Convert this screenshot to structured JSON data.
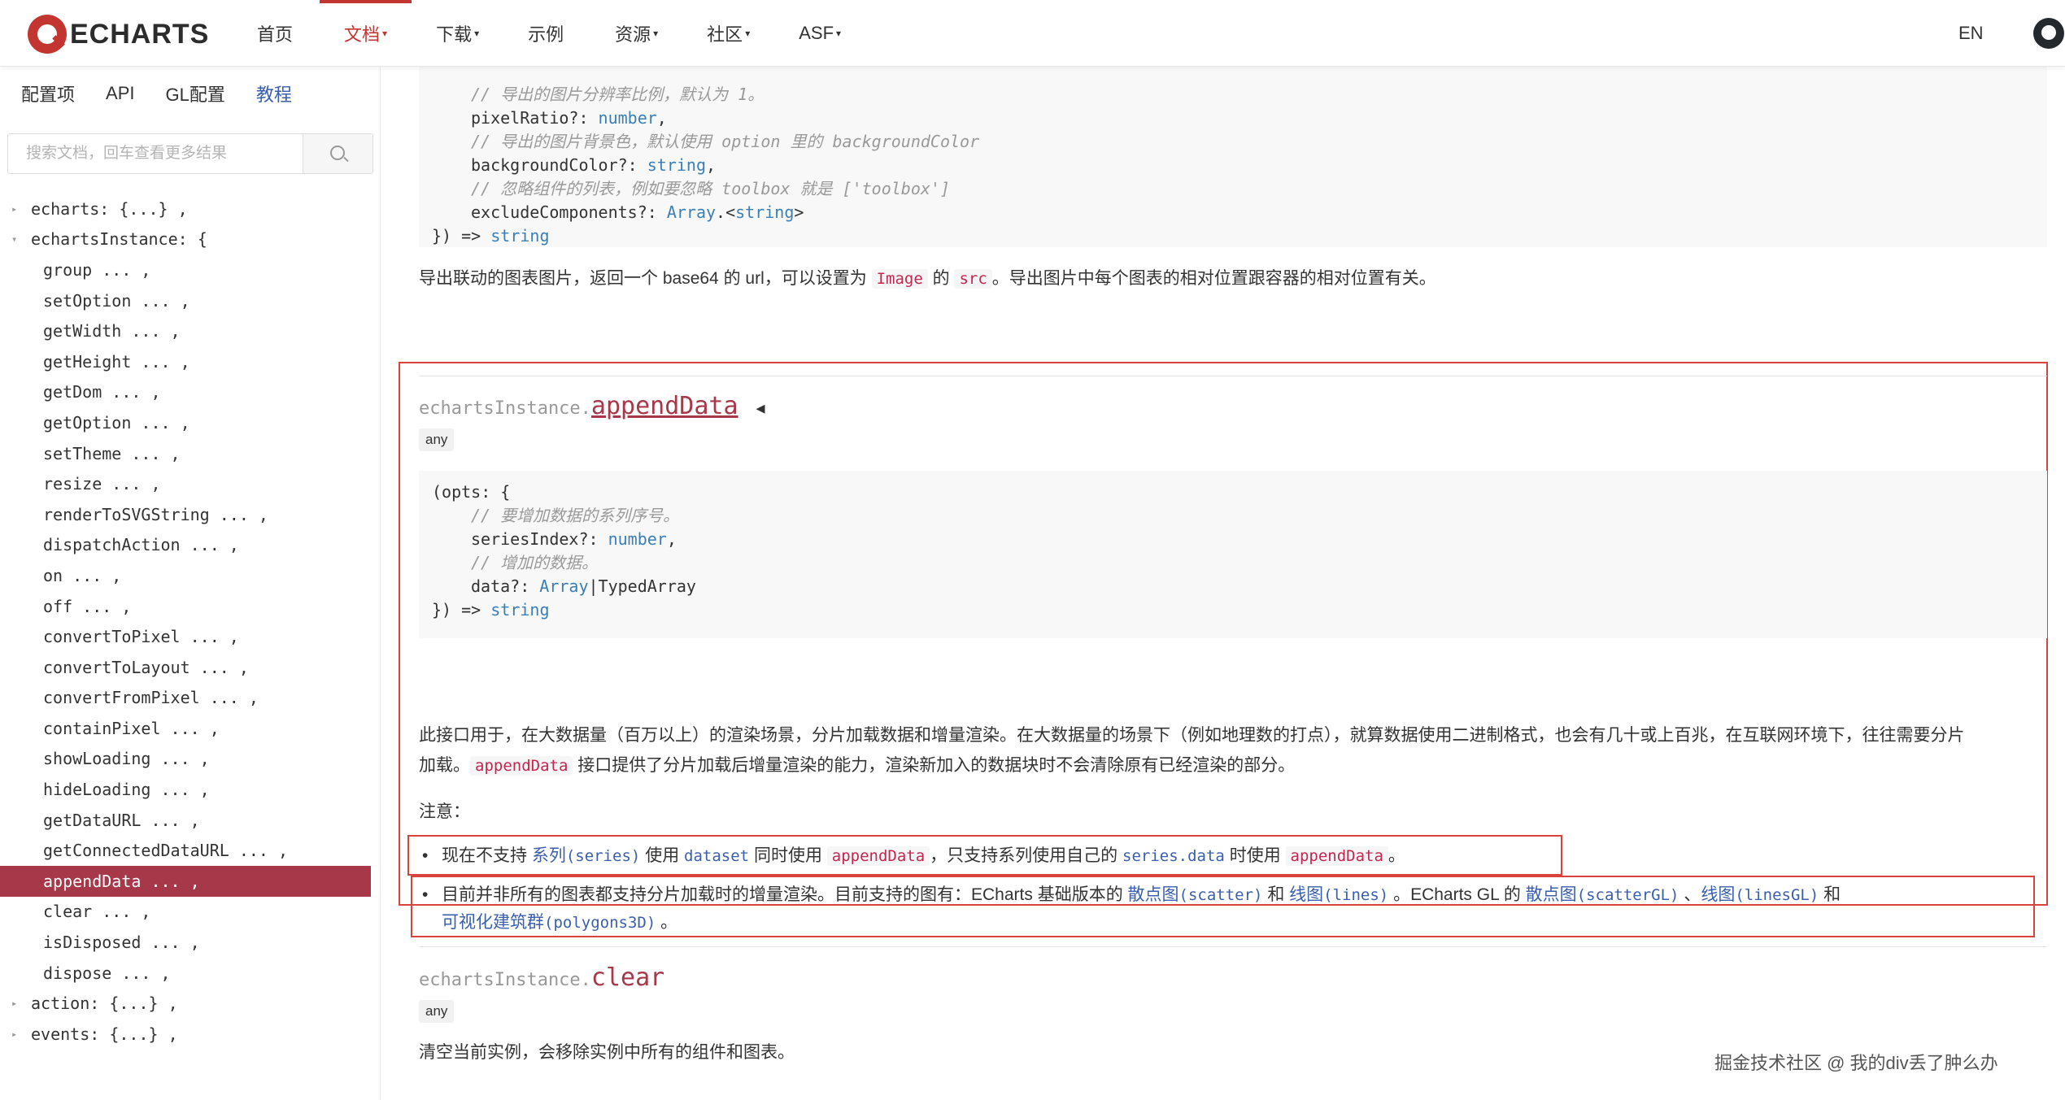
{
  "nav": {
    "logo_text": "ECHARTS",
    "items": [
      {
        "label": "首页",
        "caret": ""
      },
      {
        "label": "文档",
        "caret": "▾"
      },
      {
        "label": "下载",
        "caret": "▾"
      },
      {
        "label": "示例",
        "caret": ""
      },
      {
        "label": "资源",
        "caret": "▾"
      },
      {
        "label": "社区",
        "caret": "▾"
      },
      {
        "label": "ASF",
        "caret": "▾"
      }
    ],
    "lang": "EN"
  },
  "sidebar": {
    "tabs": [
      "配置项",
      "API",
      "GL配置",
      "教程"
    ],
    "search_placeholder": "搜索文档，回车查看更多结果",
    "tree": [
      {
        "text": "echarts: {...} ,",
        "lvl": 0,
        "arrow": "▸"
      },
      {
        "text": "echartsInstance: {",
        "lvl": 0,
        "arrow": "▾"
      },
      {
        "text": "group ... ,",
        "lvl": 1
      },
      {
        "text": "setOption ... ,",
        "lvl": 1
      },
      {
        "text": "getWidth ... ,",
        "lvl": 1
      },
      {
        "text": "getHeight ... ,",
        "lvl": 1
      },
      {
        "text": "getDom ... ,",
        "lvl": 1
      },
      {
        "text": "getOption ... ,",
        "lvl": 1
      },
      {
        "text": "setTheme ... ,",
        "lvl": 1
      },
      {
        "text": "resize ... ,",
        "lvl": 1
      },
      {
        "text": "renderToSVGString ... ,",
        "lvl": 1
      },
      {
        "text": "dispatchAction ... ,",
        "lvl": 1
      },
      {
        "text": "on ... ,",
        "lvl": 1
      },
      {
        "text": "off ... ,",
        "lvl": 1
      },
      {
        "text": "convertToPixel ... ,",
        "lvl": 1
      },
      {
        "text": "convertToLayout ... ,",
        "lvl": 1
      },
      {
        "text": "convertFromPixel ... ,",
        "lvl": 1
      },
      {
        "text": "containPixel ... ,",
        "lvl": 1
      },
      {
        "text": "showLoading ... ,",
        "lvl": 1
      },
      {
        "text": "hideLoading ... ,",
        "lvl": 1
      },
      {
        "text": "getDataURL ... ,",
        "lvl": 1
      },
      {
        "text": "getConnectedDataURL ... ,",
        "lvl": 1
      },
      {
        "text": "appendData ... ,",
        "lvl": 1,
        "selected": true
      },
      {
        "text": "clear ... ,",
        "lvl": 1
      },
      {
        "text": "isDisposed ... ,",
        "lvl": 1
      },
      {
        "text": "dispose ... ,",
        "lvl": 1
      },
      {
        "text": "action: {...} ,",
        "lvl": 0,
        "arrow": "▸"
      },
      {
        "text": "events: {...} ,",
        "lvl": 0,
        "arrow": "▸"
      }
    ]
  },
  "top_code": {
    "c1": "// 导出的图片分辨率比例，默认为 1。",
    "l1a": "pixelRatio?: ",
    "l1b": "number",
    "l1c": ",",
    "c2": "// 导出的图片背景色，默认使用 option 里的 backgroundColor",
    "l2a": "backgroundColor?: ",
    "l2b": "string",
    "l2c": ",",
    "c3": "// 忽略组件的列表，例如要忽略 toolbox 就是 ['toolbox']",
    "l3a": "excludeComponents?: ",
    "l3b": "Array",
    "l3c": ".<",
    "l3d": "string",
    "l3e": ">",
    "end_a": "}) => ",
    "end_b": "string"
  },
  "top_desc": {
    "t1": "导出联动的图表图片，返回一个 base64 的 url，可以设置为 ",
    "code1": "Image",
    "t2": " 的 ",
    "code2": "src",
    "t3": "。导出图片中每个图表的相对位置跟容器的相对位置有关。"
  },
  "append": {
    "prefix": "echartsInstance.",
    "name": "appendData",
    "back_icon": "◂",
    "badge": "any",
    "code": {
      "open": "(opts: {",
      "c1": "// 要增加数据的系列序号。",
      "l1a": "seriesIndex?: ",
      "l1b": "number",
      "l1c": ",",
      "c2": "// 增加的数据。",
      "l2a": "data?: ",
      "l2b": "Array",
      "l2c": "|TypedArray",
      "end_a": "}) => ",
      "end_b": "string"
    },
    "desc1": "此接口用于，在大数据量（百万以上）的渲染场景，分片加载数据和增量渲染。在大数据量的场景下（例如地理数的打点），就算数据使用二进制格式，也会有几十或上百兆，在互联网环境下，往往需要分片",
    "desc2a": "加载。",
    "desc2_code": "appendData",
    "desc2b": " 接口提供了分片加载后增量渲染的能力，渲染新加入的数据块时不会清除原有已经渲染的部分。",
    "note_label": "注意：",
    "b1": {
      "t1": "现在不支持 ",
      "link1": "系列",
      "link1m": "(series)",
      "t2": " 使用 ",
      "code1": "dataset",
      "t3": " 同时使用 ",
      "code2": "appendData",
      "t4": "，只支持系列使用自己的 ",
      "code3": "series.data",
      "t5": " 时使用 ",
      "code4": "appendData",
      "t6": "。"
    },
    "b2": {
      "t1": "目前并非所有的图表都支持分片加载时的增量渲染。目前支持的图有：ECharts 基础版本的 ",
      "l1": "散点图",
      "l1m": "(scatter)",
      "t2": " 和 ",
      "l2": "线图",
      "l2m": "(lines)",
      "t3": " 。ECharts GL 的 ",
      "l3": "散点图",
      "l3m": "(scatterGL)",
      "t4": " 、",
      "l4": "线图",
      "l4m": "(linesGL)",
      "t5": " 和",
      "l5": "可视化建筑群",
      "l5m": "(polygons3D)",
      "t6": " 。"
    }
  },
  "clear": {
    "prefix": "echartsInstance.",
    "name": "clear",
    "badge": "any",
    "desc": "清空当前实例，会移除实例中所有的组件和图表。"
  },
  "watermark": "掘金技术社区 @ 我的div丢了肿么办"
}
